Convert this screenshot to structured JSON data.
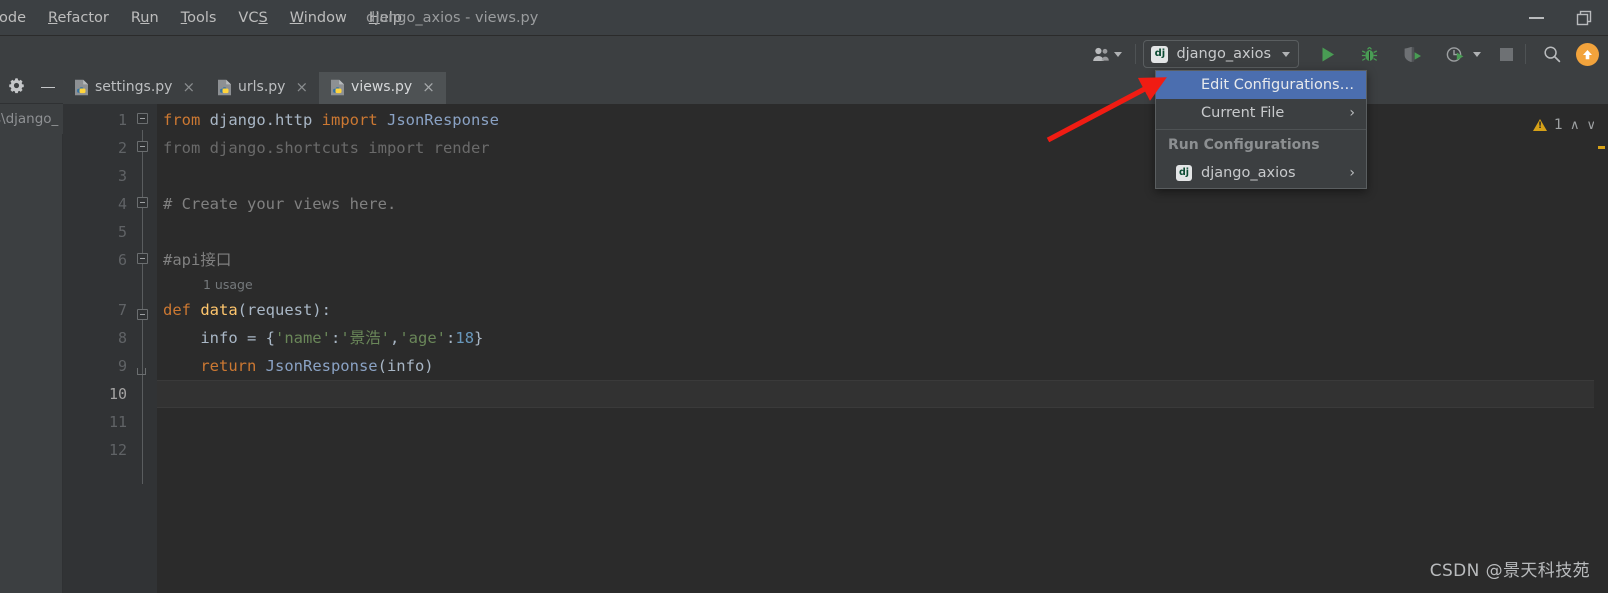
{
  "window": {
    "title": "django_axios - views.py",
    "controls": [
      {
        "name": "minimize",
        "glyph": "minimize-icon"
      },
      {
        "name": "restore",
        "glyph": "restore-icon"
      }
    ]
  },
  "menubar": {
    "items": [
      {
        "label": "ode",
        "mnemonic": ""
      },
      {
        "label": "Refactor",
        "mnemonic": "R"
      },
      {
        "label": "Run",
        "mnemonic": "u"
      },
      {
        "label": "Tools",
        "mnemonic": "T"
      },
      {
        "label": "VCS",
        "mnemonic": "S"
      },
      {
        "label": "Window",
        "mnemonic": "W"
      },
      {
        "label": "Help",
        "mnemonic": "H"
      }
    ]
  },
  "toolbar": {
    "avatar_label": "user-accounts",
    "run_config": {
      "name": "django_axios",
      "icon_text": "dj"
    },
    "buttons": [
      {
        "name": "run-button",
        "label": "Run"
      },
      {
        "name": "debug-button",
        "label": "Debug"
      },
      {
        "name": "coverage-button",
        "label": "Run with Coverage"
      },
      {
        "name": "profile-button",
        "label": "Profile"
      },
      {
        "name": "stop-button",
        "label": "Stop"
      },
      {
        "name": "search-everywhere-button",
        "label": "Search Everywhere"
      },
      {
        "name": "update-button",
        "label": "Update Project"
      }
    ]
  },
  "left_strip": {
    "gear_label": "settings-gear",
    "hide_label": "hide-tool-window"
  },
  "tabs": [
    {
      "label": "settings.py",
      "active": false,
      "close": "×"
    },
    {
      "label": "urls.py",
      "active": false,
      "close": "×"
    },
    {
      "label": "views.py",
      "active": true,
      "close": "×"
    }
  ],
  "breadcrumb": {
    "text": "s\\django_"
  },
  "editor": {
    "inspection": {
      "warning_count": "1",
      "up": "∧",
      "down": "∨"
    },
    "inlay_hints": [
      {
        "line": 7,
        "text": "1 usage"
      }
    ],
    "current_line": 10,
    "line_numbers": [
      "1",
      "2",
      "3",
      "4",
      "5",
      "6",
      "7",
      "8",
      "9",
      "10",
      "11",
      "12"
    ],
    "lines": [
      {
        "n": 1,
        "tokens": [
          {
            "t": "from ",
            "c": "kw"
          },
          {
            "t": "django.http ",
            "c": "ident"
          },
          {
            "t": "import ",
            "c": "kw"
          },
          {
            "t": "JsonResponse",
            "c": "type"
          }
        ]
      },
      {
        "n": 2,
        "tokens": [
          {
            "t": "from django.shortcuts import render",
            "c": "dim"
          }
        ]
      },
      {
        "n": 3,
        "tokens": []
      },
      {
        "n": 4,
        "tokens": [
          {
            "t": "# Create your views here.",
            "c": "cmt"
          }
        ]
      },
      {
        "n": 5,
        "tokens": []
      },
      {
        "n": 6,
        "tokens": [
          {
            "t": "#api接口",
            "c": "cmt"
          }
        ]
      },
      {
        "n": 7,
        "tokens": [
          {
            "t": "def ",
            "c": "kw"
          },
          {
            "t": "data",
            "c": "fn"
          },
          {
            "t": "(request):",
            "c": "ident"
          }
        ]
      },
      {
        "n": 8,
        "tokens": [
          {
            "t": "    info = {",
            "c": "ident"
          },
          {
            "t": "'name'",
            "c": "str"
          },
          {
            "t": ":",
            "c": "ident"
          },
          {
            "t": "'景浩'",
            "c": "str"
          },
          {
            "t": ",",
            "c": "ident"
          },
          {
            "t": "'age'",
            "c": "str"
          },
          {
            "t": ":",
            "c": "ident"
          },
          {
            "t": "18",
            "c": "num"
          },
          {
            "t": "}",
            "c": "ident"
          }
        ]
      },
      {
        "n": 9,
        "tokens": [
          {
            "t": "    ",
            "c": "ident"
          },
          {
            "t": "return ",
            "c": "kw"
          },
          {
            "t": "JsonResponse",
            "c": "type"
          },
          {
            "t": "(info)",
            "c": "ident"
          }
        ]
      },
      {
        "n": 10,
        "tokens": []
      },
      {
        "n": 11,
        "tokens": []
      },
      {
        "n": 12,
        "tokens": []
      }
    ]
  },
  "run_config_dropdown": {
    "items": [
      {
        "label": "Edit Configurations…",
        "selected": true,
        "arrow": "",
        "icon": ""
      },
      {
        "label": "Current File",
        "selected": false,
        "arrow": "›",
        "icon": ""
      }
    ],
    "section_header": "Run Configurations",
    "configs": [
      {
        "label": "django_axios",
        "arrow": "›",
        "icon_text": "dj"
      }
    ]
  },
  "annotation": {
    "arrow_color": "#f01c13"
  },
  "watermark": {
    "text": "CSDN @景天科技苑"
  },
  "colors": {
    "bg_chrome": "#3c3f41",
    "bg_editor": "#2b2b2b",
    "accent_selection": "#4b6eaf",
    "run_green": "#499c54",
    "warn_yellow": "#d6a117",
    "update_orange": "#f2a33c"
  }
}
